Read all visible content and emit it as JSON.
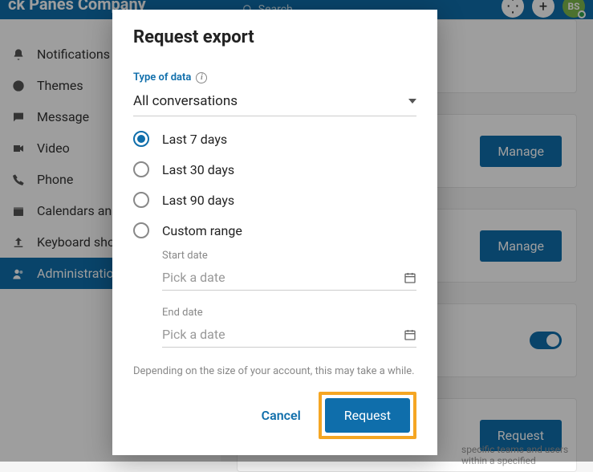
{
  "topbar": {
    "title_fragment": "ck Panes Company",
    "search_placeholder": "Search",
    "avatar_initials": "BS"
  },
  "sidebar": {
    "items": [
      {
        "label": "Notifications and sounds",
        "icon": "bell"
      },
      {
        "label": "Themes",
        "icon": "globe"
      },
      {
        "label": "Message",
        "icon": "message"
      },
      {
        "label": "Video",
        "icon": "video"
      },
      {
        "label": "Phone",
        "icon": "phone"
      },
      {
        "label": "Calendars and contacts",
        "icon": "calendar"
      },
      {
        "label": "Keyboard shortcuts",
        "icon": "upload"
      },
      {
        "label": "Administration",
        "icon": "admin"
      }
    ]
  },
  "main": {
    "cards": {
      "0": {
        "action_label": "Manage"
      },
      "1": {
        "action_label": "Manage"
      },
      "3": {
        "action_label": "Request"
      }
    },
    "footer_text": "specific teams and users within a specified"
  },
  "modal": {
    "title": "Request export",
    "type_label": "Type of data",
    "type_value": "All conversations",
    "ranges": {
      "0": {
        "label": "Last 7 days"
      },
      "1": {
        "label": "Last 30 days"
      },
      "2": {
        "label": "Last 90 days"
      },
      "3": {
        "label": "Custom range"
      }
    },
    "start_label": "Start date",
    "start_placeholder": "Pick a date",
    "end_label": "End date",
    "end_placeholder": "Pick a date",
    "note": "Depending on the size of your account, this may take a while.",
    "cancel": "Cancel",
    "request": "Request"
  }
}
